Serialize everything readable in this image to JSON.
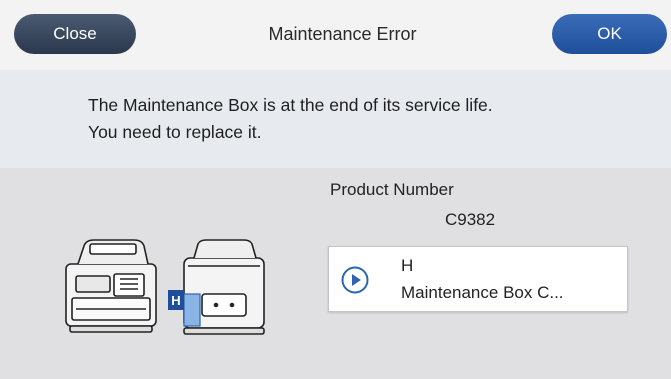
{
  "header": {
    "close_label": "Close",
    "title": "Maintenance Error",
    "ok_label": "OK"
  },
  "message": {
    "line1": "The Maintenance Box is at the end of its service life.",
    "line2": "You need to replace it."
  },
  "product": {
    "label": "Product Number",
    "number": "C9382"
  },
  "illustration": {
    "position_letter": "H"
  },
  "part": {
    "letter": "H",
    "name": "Maintenance Box C..."
  },
  "colors": {
    "close_button": "#2b384d",
    "ok_button": "#1f4f9a",
    "accent_blue": "#2f63b0"
  },
  "icons": {
    "part_card": "play-circle-icon"
  }
}
